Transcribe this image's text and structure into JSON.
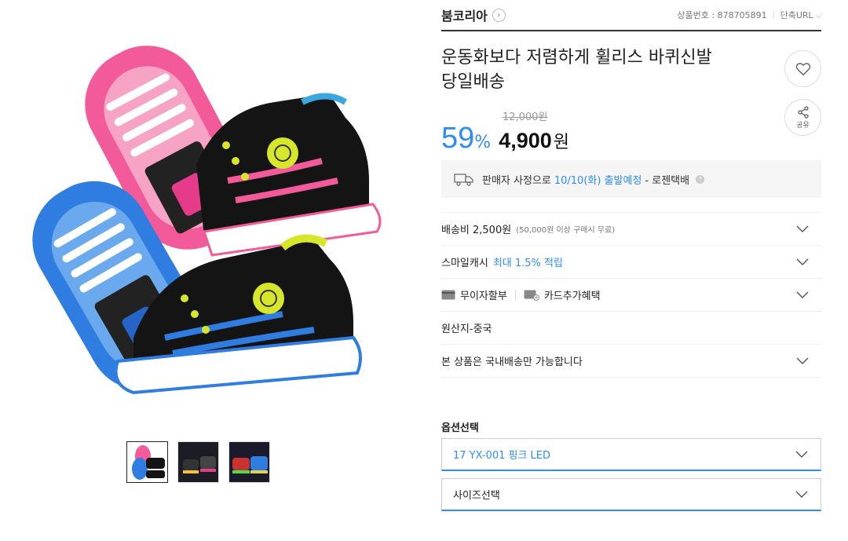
{
  "seller": {
    "name": "붐코리아"
  },
  "meta": {
    "product_no_label": "상품번호 : 878705891",
    "short_url_label": "단축URL"
  },
  "product": {
    "title_line1": "운동화보다 저렴하게 휠리스 바퀴신발",
    "title_line2": "당일배송"
  },
  "share": {
    "label": "공유"
  },
  "price": {
    "original": "12,000원",
    "discount": "59",
    "discount_unit": "%",
    "sale": "4,900",
    "sale_unit": "원"
  },
  "shipping_notice": {
    "prefix": "판매자 사정으로",
    "date": "10/10(화) 출발예정",
    "carrier": "- 로젠택배"
  },
  "rows": {
    "delivery": {
      "label": "배송비 2,500원",
      "note": "(50,000원 이상 구매시 무료)"
    },
    "smilecash": {
      "label": "스마일캐시",
      "highlight": "최대 1.5% 적립"
    },
    "payment": {
      "interest_free": "무이자할부",
      "card_benefit": "카드추가혜택"
    },
    "origin": {
      "label": "원산지-중국"
    },
    "domestic": {
      "label": "본 상품은 국내배송만 가능합니다"
    }
  },
  "options": {
    "label": "옵션선택",
    "selected_option": "17 YX-001 핑크 LED",
    "size_placeholder": "사이즈선택"
  },
  "colors": {
    "accent": "#2e8df5",
    "pink": "#f25a9a",
    "blue": "#2f7de0",
    "lime": "#d6e62a"
  }
}
